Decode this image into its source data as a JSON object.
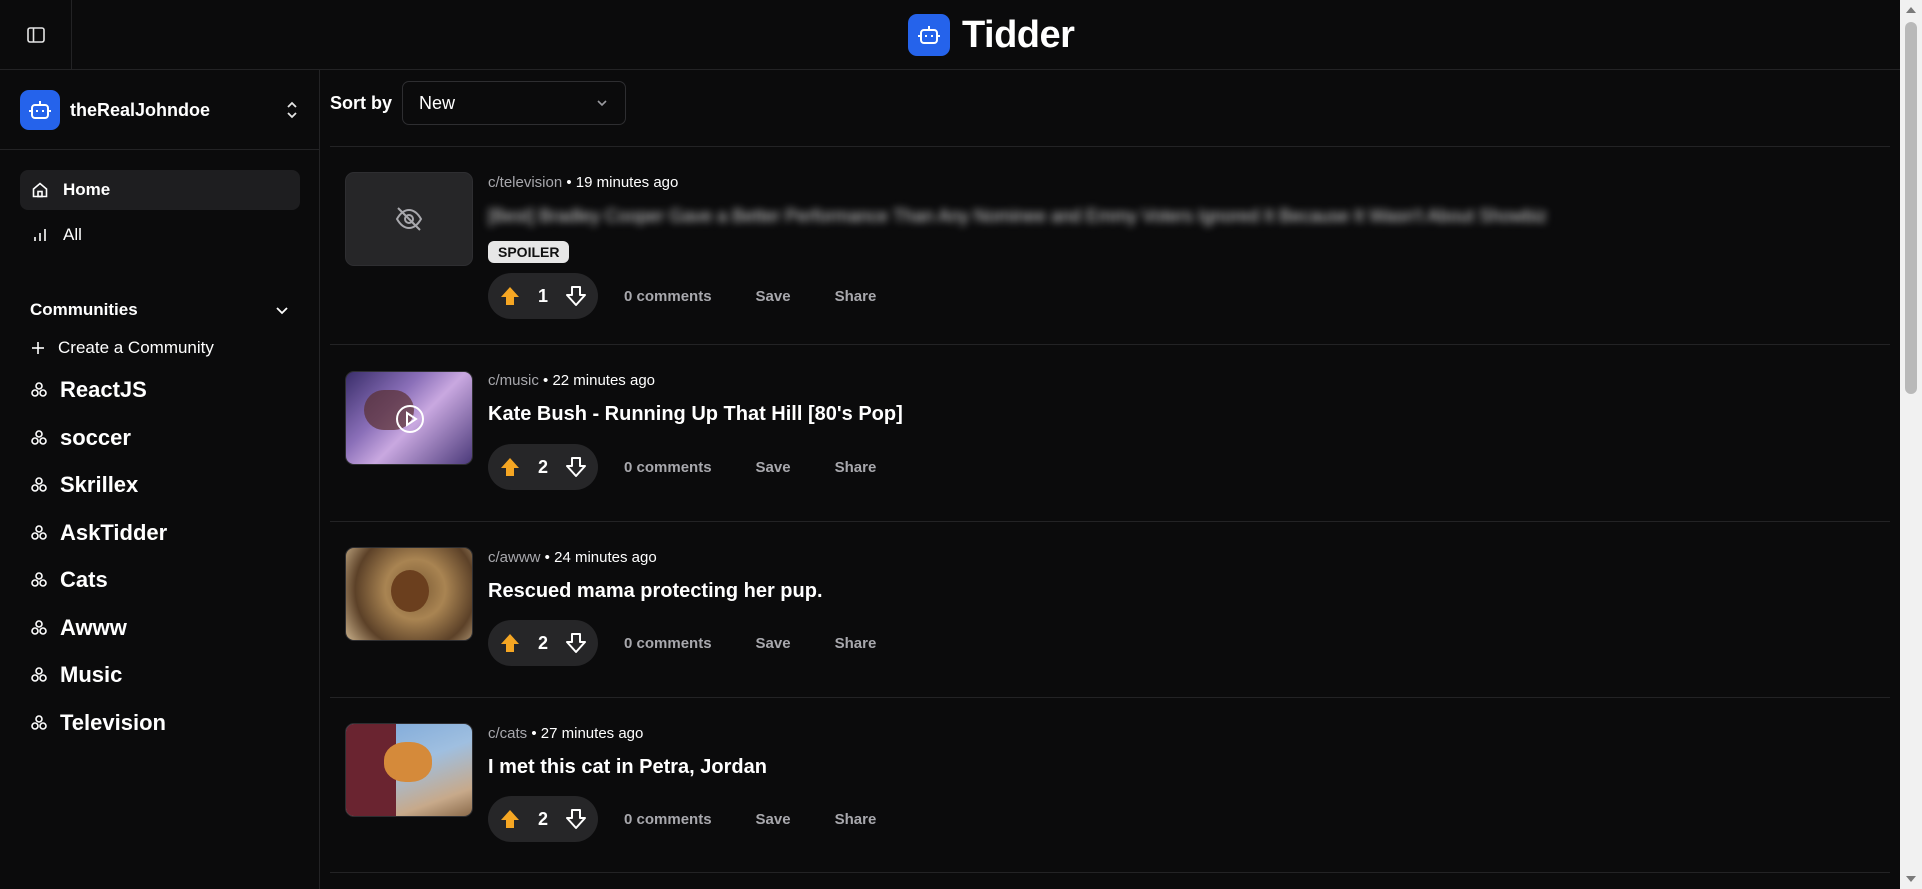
{
  "app": {
    "name": "Tidder"
  },
  "user": {
    "name": "theRealJohndoe"
  },
  "nav": [
    {
      "label": "Home",
      "icon": "home-icon",
      "active": true
    },
    {
      "label": "All",
      "icon": "bar-chart-icon",
      "active": false
    }
  ],
  "communities": {
    "title": "Communities",
    "create_label": "Create a Community",
    "items": [
      "ReactJS",
      "soccer",
      "Skrillex",
      "AskTidder",
      "Cats",
      "Awww",
      "Music",
      "Television"
    ]
  },
  "sort": {
    "label": "Sort by",
    "value": "New"
  },
  "posts": [
    {
      "community": "c/television",
      "separator": " • ",
      "time": "19 minutes ago",
      "title": "[Best] Bradley Cooper Gave a Better Performance Than Any Nominee and Emmy Voters Ignored It Because It Wasn't About Showbiz",
      "spoiler": "SPOILER",
      "votes": "1",
      "comments": "0 comments",
      "save": "Save",
      "share": "Share",
      "thumb": "hidden-eye-icon"
    },
    {
      "community": "c/music",
      "separator": " • ",
      "time": "22 minutes ago",
      "title": "Kate Bush - Running Up That Hill [80's Pop]",
      "votes": "2",
      "comments": "0 comments",
      "save": "Save",
      "share": "Share",
      "thumb": "video-thumbnail"
    },
    {
      "community": "c/awww",
      "separator": " • ",
      "time": "24 minutes ago",
      "title": "Rescued mama protecting her pup.",
      "votes": "2",
      "comments": "0 comments",
      "save": "Save",
      "share": "Share",
      "thumb": "dog-thumbnail"
    },
    {
      "community": "c/cats",
      "separator": " • ",
      "time": "27 minutes ago",
      "title": "I met this cat in Petra, Jordan",
      "votes": "2",
      "comments": "0 comments",
      "save": "Save",
      "share": "Share",
      "thumb": "cat-thumbnail"
    }
  ],
  "colors": {
    "accent": "#2563eb",
    "upvote": "#f5a623",
    "background": "#0b0b0c"
  }
}
